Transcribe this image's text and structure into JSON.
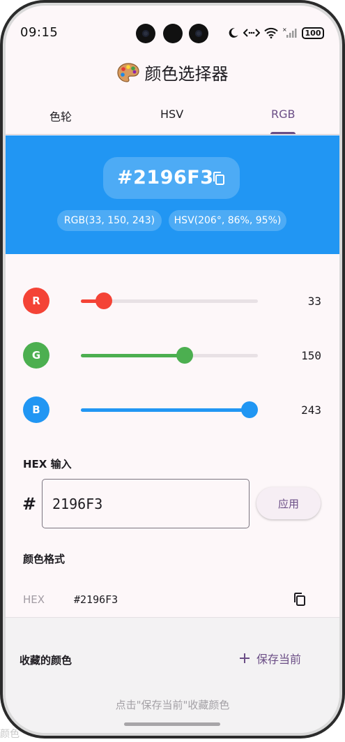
{
  "status_bar": {
    "time": "09:15",
    "battery": "100"
  },
  "app": {
    "title": "颜色选择器"
  },
  "tabs": [
    {
      "label": "色轮",
      "active": false
    },
    {
      "label": "HSV",
      "active": false
    },
    {
      "label": "RGB",
      "active": true
    }
  ],
  "preview": {
    "color": "#2196F3",
    "hex": "#2196F3",
    "rgb_chip": "RGB(33, 150, 243)",
    "hsv_chip": "HSV(206°, 86%, 95%)"
  },
  "sliders": [
    {
      "channel": "R",
      "value": "33",
      "fraction": 0.129,
      "color": "#f44336"
    },
    {
      "channel": "G",
      "value": "150",
      "fraction": 0.588,
      "color": "#4caf50"
    },
    {
      "channel": "B",
      "value": "243",
      "fraction": 0.953,
      "color": "#2196f3"
    }
  ],
  "hex_input": {
    "label": "HEX 输入",
    "hash": "#",
    "value": "2196F3",
    "apply_label": "应用"
  },
  "formats": {
    "label": "颜色格式",
    "rows": [
      {
        "key": "HEX",
        "value": "#2196F3"
      }
    ]
  },
  "favorites": {
    "title": "收藏的颜色",
    "save_label": "保存当前",
    "hint": "点击\"保存当前\"收藏颜色"
  },
  "edge_text": "颜色",
  "colors": {
    "accent": "#6b4e86",
    "surface": "#fdf7f9"
  }
}
